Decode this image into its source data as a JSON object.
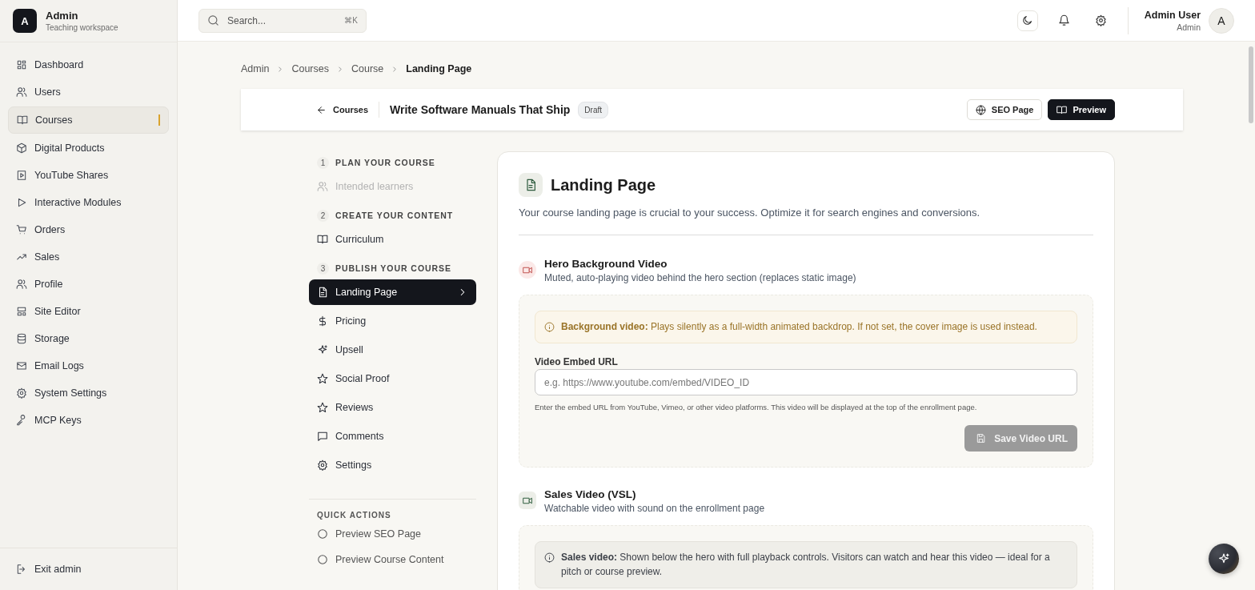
{
  "workspace": {
    "avatar": "A",
    "name": "Admin",
    "subtitle": "Teaching workspace"
  },
  "sidebar": {
    "items": [
      {
        "label": "Dashboard",
        "selected": false
      },
      {
        "label": "Users",
        "selected": false
      },
      {
        "label": "Courses",
        "selected": true
      },
      {
        "label": "Digital Products",
        "selected": false
      },
      {
        "label": "YouTube Shares",
        "selected": false
      },
      {
        "label": "Interactive Modules",
        "selected": false
      },
      {
        "label": "Orders",
        "selected": false
      },
      {
        "label": "Sales",
        "selected": false
      },
      {
        "label": "Profile",
        "selected": false
      },
      {
        "label": "Site Editor",
        "selected": false
      },
      {
        "label": "Storage",
        "selected": false
      },
      {
        "label": "Email Logs",
        "selected": false
      },
      {
        "label": "System Settings",
        "selected": false
      },
      {
        "label": "MCP Keys",
        "selected": false
      }
    ],
    "footer": "Exit admin"
  },
  "topbar": {
    "search": {
      "placeholder": "Search...",
      "shortcut": "⌘K"
    },
    "user": {
      "name": "Admin User",
      "role": "Admin",
      "avatar": "A"
    }
  },
  "breadcrumb": [
    "Admin",
    "Courses",
    "Course",
    "Landing Page"
  ],
  "course_header": {
    "back": "Courses",
    "title": "Write Software Manuals That Ship",
    "status": "Draft",
    "buttons": [
      {
        "label": "SEO Page",
        "kind": "outline"
      },
      {
        "label": "Preview",
        "kind": "primary"
      }
    ]
  },
  "steps": [
    {
      "number": "1",
      "title": "PLAN YOUR COURSE",
      "items": [
        {
          "label": "Intended learners",
          "disabled": true,
          "selected": false
        }
      ]
    },
    {
      "number": "2",
      "title": "CREATE YOUR CONTENT",
      "items": [
        {
          "label": "Curriculum",
          "disabled": false,
          "selected": false
        }
      ]
    },
    {
      "number": "3",
      "title": "PUBLISH YOUR COURSE",
      "items": [
        {
          "label": "Landing Page",
          "disabled": false,
          "selected": true
        },
        {
          "label": "Pricing",
          "disabled": false,
          "selected": false
        },
        {
          "label": "Upsell",
          "disabled": false,
          "selected": false
        },
        {
          "label": "Social Proof",
          "disabled": false,
          "selected": false
        },
        {
          "label": "Reviews",
          "disabled": false,
          "selected": false
        },
        {
          "label": "Comments",
          "disabled": false,
          "selected": false
        },
        {
          "label": "Settings",
          "disabled": false,
          "selected": false
        }
      ]
    }
  ],
  "quick_actions": {
    "title": "QUICK ACTIONS",
    "items": [
      "Preview SEO Page",
      "Preview Course Content"
    ]
  },
  "page": {
    "title": "Landing Page",
    "description": "Your course landing page is crucial to your success. Optimize it for search engines and conversions."
  },
  "sections": [
    {
      "kind": "hero",
      "title": "Hero Background Video",
      "subtitle": "Muted, auto-playing video behind the hero section (replaces static image)",
      "note": {
        "kind": "warning",
        "text": "**Background video:** Plays silently as a full-width animated backdrop. If not set, the cover image is used instead."
      },
      "field": {
        "label": "Video Embed URL",
        "placeholder": "e.g. https://www.youtube.com/embed/VIDEO_ID",
        "help": "Enter the embed URL from YouTube, Vimeo, or other video platforms. This video will be displayed at the top of the enrollment page."
      },
      "button": {
        "label": "Save Video URL",
        "disabled": true
      }
    },
    {
      "kind": "sales",
      "title": "Sales Video (VSL)",
      "subtitle": "Watchable video with sound on the enrollment page",
      "note": {
        "kind": "info",
        "text": "**Sales video:** Shown below the hero with full playback controls. Visitors can watch and hear this video — ideal for a pitch or course preview."
      }
    }
  ]
}
